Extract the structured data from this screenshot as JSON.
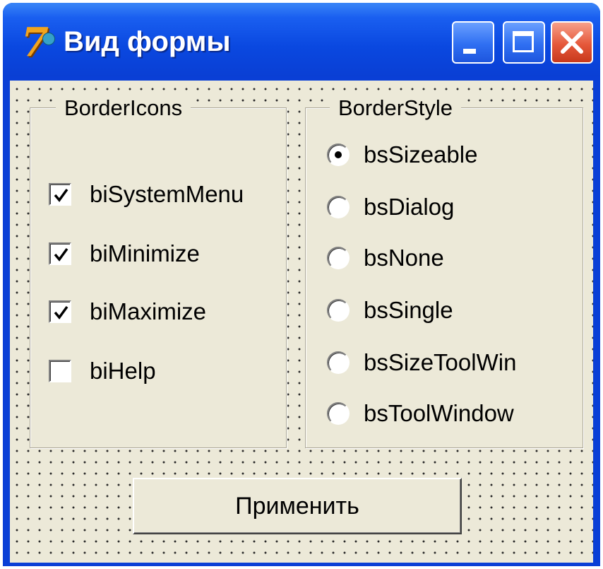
{
  "window": {
    "title": "Вид формы",
    "icon": "delphi-7-icon",
    "controls": {
      "minimize": "minimize-icon",
      "maximize": "maximize-icon",
      "close": "close-icon"
    }
  },
  "border_icons": {
    "legend": "BorderIcons",
    "items": [
      {
        "label": "biSystemMenu",
        "checked": true
      },
      {
        "label": "biMinimize",
        "checked": true
      },
      {
        "label": "biMaximize",
        "checked": true
      },
      {
        "label": "biHelp",
        "checked": false
      }
    ]
  },
  "border_style": {
    "legend": "BorderStyle",
    "selected": "bsSizeable",
    "items": [
      {
        "label": "bsSizeable",
        "selected": true
      },
      {
        "label": "bsDialog",
        "selected": false
      },
      {
        "label": "bsNone",
        "selected": false
      },
      {
        "label": "bsSingle",
        "selected": false
      },
      {
        "label": "bsSizeToolWin",
        "selected": false
      },
      {
        "label": "bsToolWindow",
        "selected": false
      }
    ]
  },
  "apply_button": {
    "label": "Применить"
  },
  "colors": {
    "titlebar": "#0a48e0",
    "client_bg": "#ece9d8",
    "close_button": "#e5583a"
  }
}
